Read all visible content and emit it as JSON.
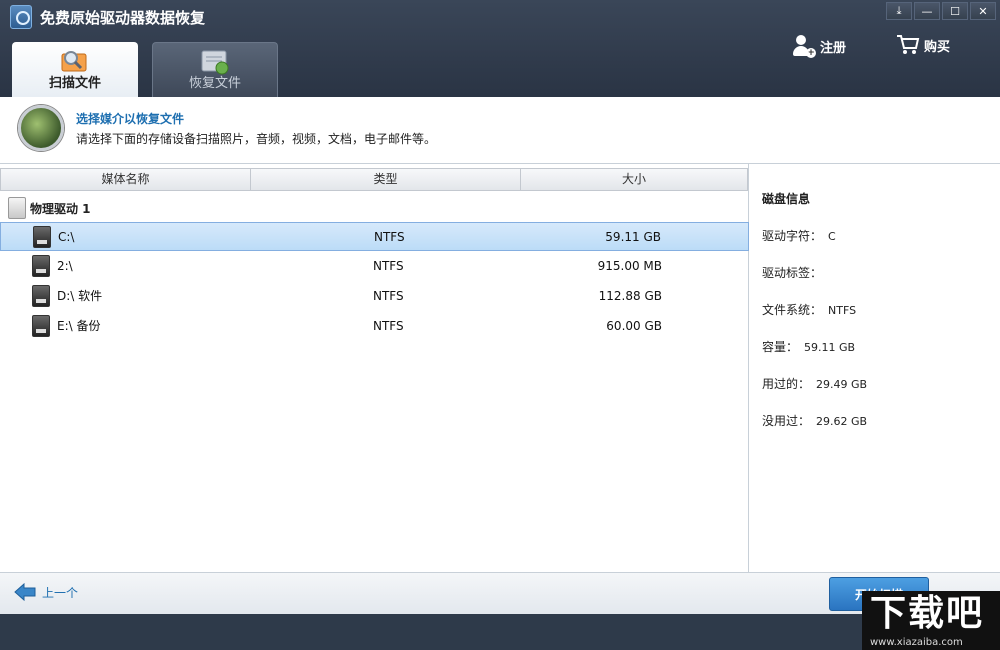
{
  "app": {
    "title": "免费原始驱动器数据恢复"
  },
  "window_buttons": [
    "⤓",
    "—",
    "☐",
    "✕"
  ],
  "top_actions": {
    "register": "注册",
    "buy": "购买"
  },
  "tabs": [
    {
      "label": "扫描文件",
      "active": true
    },
    {
      "label": "恢复文件",
      "active": false
    }
  ],
  "header": {
    "title": "选择媒介以恢复文件",
    "subtitle": "请选择下面的存储设备扫描照片，音频，视频，文档，电子邮件等。"
  },
  "table": {
    "columns": [
      "媒体名称",
      "类型",
      "大小"
    ],
    "group_label": "物理驱动 1",
    "rows": [
      {
        "name": "C:\\",
        "type": "NTFS",
        "size": "59.11 GB",
        "selected": true
      },
      {
        "name": "2:\\",
        "type": "NTFS",
        "size": "915.00 MB",
        "selected": false
      },
      {
        "name": "D:\\ 软件",
        "type": "NTFS",
        "size": "112.88 GB",
        "selected": false
      },
      {
        "name": "E:\\ 备份",
        "type": "NTFS",
        "size": "60.00 GB",
        "selected": false
      }
    ]
  },
  "disk_info": {
    "title": "磁盘信息",
    "fields": [
      {
        "label": "驱动字符：",
        "value": "C"
      },
      {
        "label": "驱动标签：",
        "value": ""
      },
      {
        "label": "文件系统：",
        "value": "NTFS"
      },
      {
        "label": "容量：",
        "value": "59.11 GB"
      },
      {
        "label": "用过的：",
        "value": "29.49 GB"
      },
      {
        "label": "没用过：",
        "value": "29.62 GB"
      }
    ]
  },
  "footer": {
    "back": "上一个",
    "start": "开始扫描"
  },
  "watermark": {
    "big": "下载吧",
    "small": "www.xiazaiba.com"
  },
  "colors": {
    "accent": "#1e6fb0",
    "selection": "#bcdcf7",
    "titlebar": "#2e3a4a"
  }
}
